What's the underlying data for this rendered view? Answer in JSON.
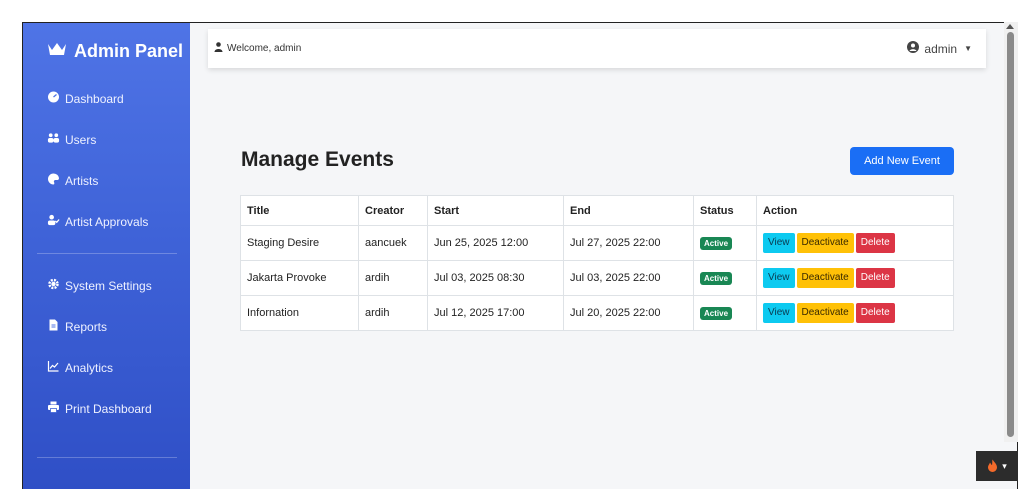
{
  "sidebar": {
    "brand": "Admin Panel",
    "items": [
      {
        "label": "Dashboard",
        "icon": "tachometer-icon"
      },
      {
        "label": "Users",
        "icon": "users-icon"
      },
      {
        "label": "Artists",
        "icon": "palette-icon"
      },
      {
        "label": "Artist Approvals",
        "icon": "user-check-icon"
      },
      {
        "label": "System Settings",
        "icon": "cog-icon"
      },
      {
        "label": "Reports",
        "icon": "file-icon"
      },
      {
        "label": "Analytics",
        "icon": "chart-line-icon"
      },
      {
        "label": "Print Dashboard",
        "icon": "print-icon"
      }
    ]
  },
  "topbar": {
    "welcome": "Welcome, admin",
    "user": "admin"
  },
  "main": {
    "title": "Manage Events",
    "add_button": "Add New Event",
    "table": {
      "headers": [
        "Title",
        "Creator",
        "Start",
        "End",
        "Status",
        "Action"
      ],
      "rows": [
        {
          "title": "Staging Desire",
          "creator": "aancuek",
          "start": "Jun 25, 2025 12:00",
          "end": "Jul 27, 2025 22:00",
          "status": "Active"
        },
        {
          "title": "Jakarta Provoke",
          "creator": "ardih",
          "start": "Jul 03, 2025 08:30",
          "end": "Jul 03, 2025 22:00",
          "status": "Active"
        },
        {
          "title": "Infornation",
          "creator": "ardih",
          "start": "Jul 12, 2025 17:00",
          "end": "Jul 20, 2025 22:00",
          "status": "Active"
        }
      ],
      "actions": {
        "view": "View",
        "deactivate": "Deactivate",
        "delete": "Delete"
      }
    }
  },
  "colors": {
    "sidebar_top": "#4f74e6",
    "sidebar_bottom": "#2f4fc6",
    "primary": "#1a6ef5",
    "success": "#198754",
    "info": "#0dcaf0",
    "warning": "#ffc107",
    "danger": "#dc3545"
  }
}
